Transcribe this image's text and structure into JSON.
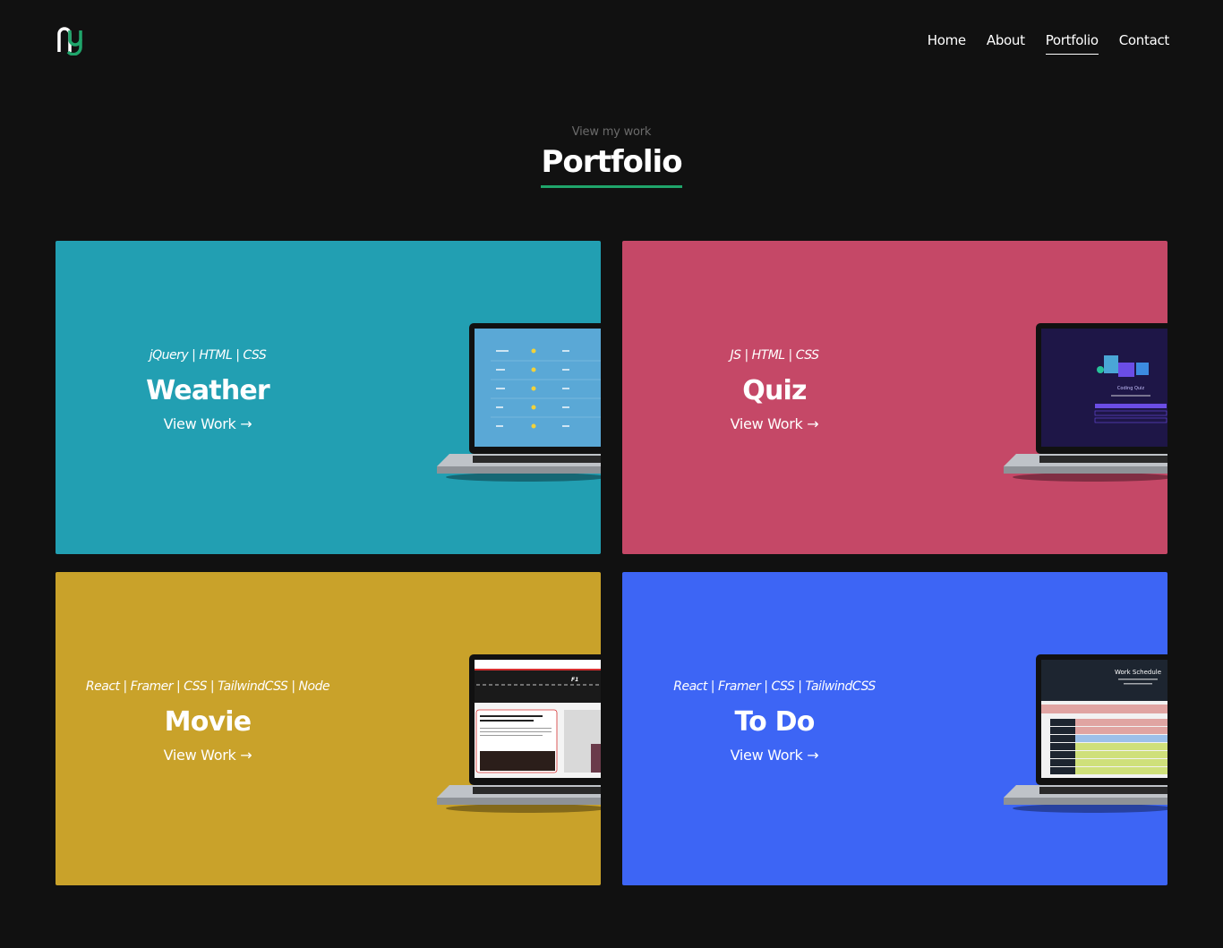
{
  "nav": {
    "items": [
      {
        "label": "Home",
        "active": false
      },
      {
        "label": "About",
        "active": false
      },
      {
        "label": "Portfolio",
        "active": true
      },
      {
        "label": "Contact",
        "active": false
      }
    ]
  },
  "section": {
    "subtitle": "View my work",
    "title": "Portfolio"
  },
  "colors": {
    "background": "#111111",
    "accent": "#1fa56b"
  },
  "projects": [
    {
      "tech": "jQuery | HTML | CSS",
      "title": "Weather",
      "link": "View Work →",
      "color": "#229fb2"
    },
    {
      "tech": "JS | HTML | CSS",
      "title": "Quiz",
      "link": "View Work →",
      "color": "#c54867"
    },
    {
      "tech": "React | Framer | CSS | TailwindCSS | Node",
      "title": "Movie",
      "link": "View Work →",
      "color": "#c9a22a"
    },
    {
      "tech": "React | Framer | CSS | TailwindCSS",
      "title": "To Do",
      "link": "View Work →",
      "color": "#3d65f5"
    }
  ],
  "screens": {
    "quiz_title": "Coding Quiz",
    "movie_brand": "F1",
    "todo_title": "Work Schedule"
  }
}
